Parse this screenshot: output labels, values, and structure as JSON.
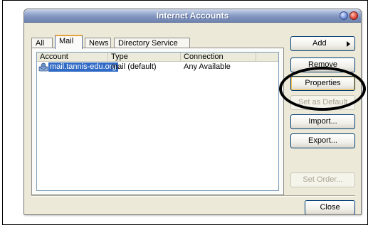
{
  "window": {
    "title": "Internet Accounts"
  },
  "tabs": [
    {
      "label": "All"
    },
    {
      "label": "Mail"
    },
    {
      "label": "News"
    },
    {
      "label": "Directory Service"
    }
  ],
  "active_tab": "Mail",
  "table": {
    "headers": [
      "Account",
      "Type",
      "Connection"
    ],
    "rows": [
      {
        "account": "mail.tannis-edu.org",
        "type": "mail (default)",
        "connection": "Any Available"
      }
    ]
  },
  "buttons": {
    "add": "Add",
    "remove": "Remove",
    "properties": "Properties",
    "set_default": "Set as Default",
    "import": "Import...",
    "export": "Export...",
    "set_order": "Set Order...",
    "close": "Close"
  },
  "icons": {
    "account_icon": "mail-account-icon",
    "add_arrow": "triangle-right-icon"
  }
}
